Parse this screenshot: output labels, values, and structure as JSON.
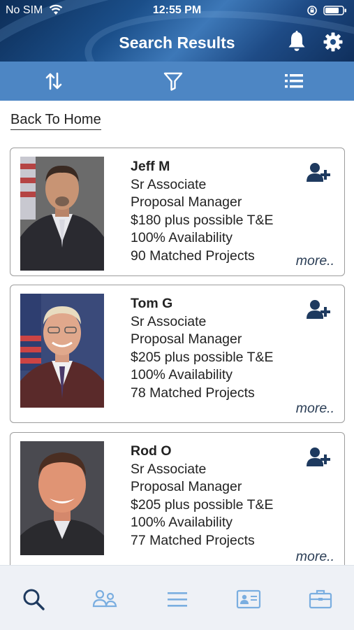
{
  "status_bar": {
    "carrier": "No SIM",
    "time": "12:55 PM"
  },
  "header": {
    "title": "Search Results"
  },
  "nav": {
    "back_label": "Back To Home"
  },
  "results": [
    {
      "name": "Jeff M",
      "level": "Sr Associate",
      "role": "Proposal Manager",
      "rate": "$180 plus possible T&E",
      "availability": "100% Availability",
      "matched": "90 Matched Projects",
      "more": "more.."
    },
    {
      "name": "Tom G",
      "level": "Sr Associate",
      "role": "Proposal Manager",
      "rate": "$205 plus possible T&E",
      "availability": "100% Availability",
      "matched": "78 Matched Projects",
      "more": "more.."
    },
    {
      "name": "Rod O",
      "level": "Sr Associate",
      "role": "Proposal Manager",
      "rate": "$205 plus possible T&E",
      "availability": "100% Availability",
      "matched": "77 Matched Projects",
      "more": "more.."
    }
  ],
  "icons": {
    "toolbar": [
      "sort-icon",
      "filter-icon",
      "list-view-icon"
    ],
    "tabs": [
      "search-icon",
      "people-icon",
      "menu-icon",
      "id-card-icon",
      "briefcase-icon"
    ],
    "header": [
      "bell-icon",
      "gear-icon"
    ]
  },
  "colors": {
    "header_dark": "#0d2d57",
    "toolbar": "#4d86c4",
    "icon_dark": "#1e3a5f",
    "tab_inactive": "#7aaee0",
    "tabbar_bg": "#eef1f6"
  }
}
